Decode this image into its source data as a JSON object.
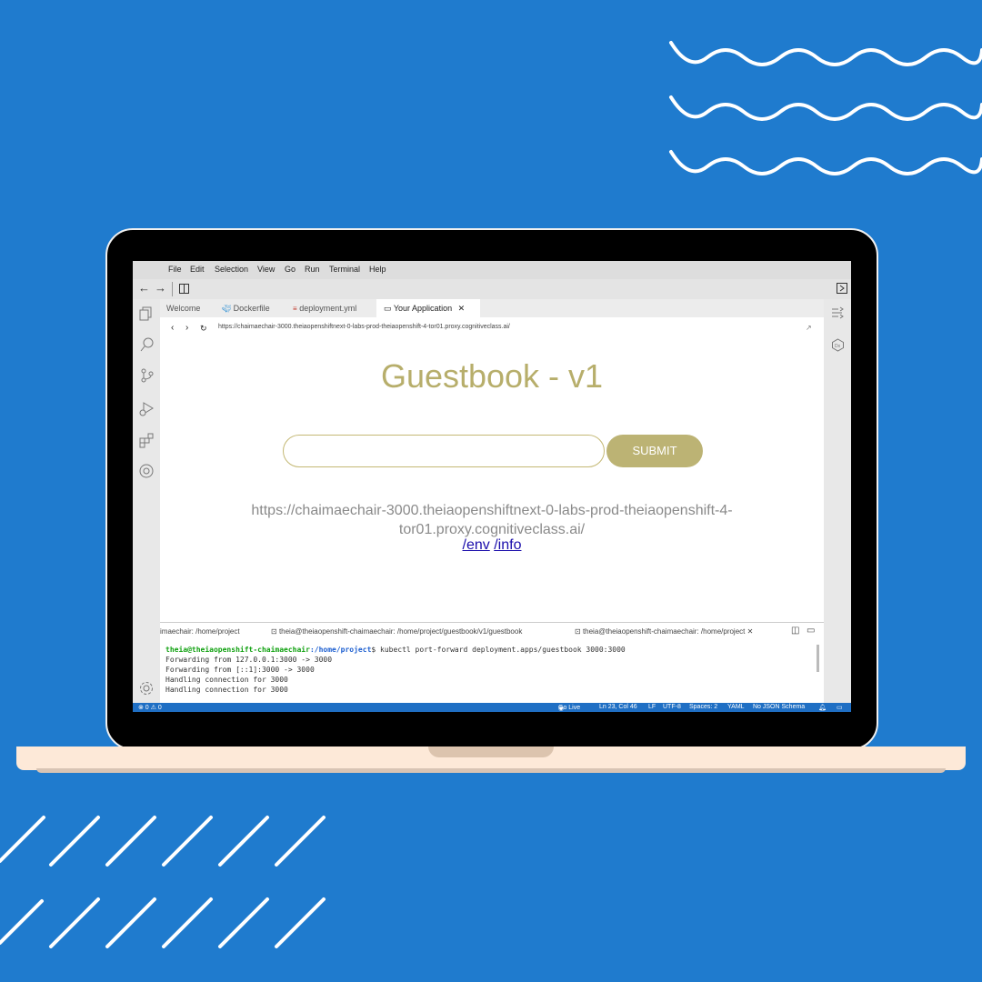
{
  "menu": [
    "File",
    "Edit",
    "Selection",
    "View",
    "Go",
    "Run",
    "Terminal",
    "Help"
  ],
  "tabs": [
    {
      "label": "Welcome"
    },
    {
      "label": "Dockerfile"
    },
    {
      "label": "deployment.yml"
    },
    {
      "label": "Your Application"
    }
  ],
  "browser": {
    "url": "https://chaimaechair-3000.theiaopenshiftnext-0-labs-prod-theiaopenshift-4-tor01.proxy.cognitiveclass.ai/"
  },
  "app": {
    "title": "Guestbook - v1",
    "submit_label": "SUBMIT",
    "host_url_line1": "https://chaimaechair-3000.theiaopenshiftnext-0-labs-prod-theiaopenshift-4-",
    "host_url_line2": "tor01.proxy.cognitiveclass.ai/",
    "link_env": "/env",
    "link_info": "/info"
  },
  "terminal_tabs": [
    "imaechair: /home/project",
    "theia@theiaopenshift-chaimaechair: /home/project/guestbook/v1/guestbook",
    "theia@theiaopenshift-chaimaechair: /home/project"
  ],
  "terminal": {
    "prompt_user": "theia@theiaopenshift-chaimaechair",
    "prompt_path": ":/home/project",
    "command": "$ kubectl port-forward deployment.apps/guestbook 3000:3000",
    "lines": [
      "Forwarding from 127.0.0.1:3000 -> 3000",
      "Forwarding from [::1]:3000 -> 3000",
      "Handling connection for 3000",
      "Handling connection for 3000"
    ]
  },
  "status": {
    "problems": "⊗ 0 ⚠ 0",
    "go_live": "Go Live",
    "position": "Ln 23, Col 46",
    "eol": "LF",
    "encoding": "UTF-8",
    "spaces": "Spaces: 2",
    "language": "YAML",
    "schema": "No JSON Schema"
  },
  "colors": {
    "background": "#1f7bce",
    "accent": "#bcb374"
  }
}
